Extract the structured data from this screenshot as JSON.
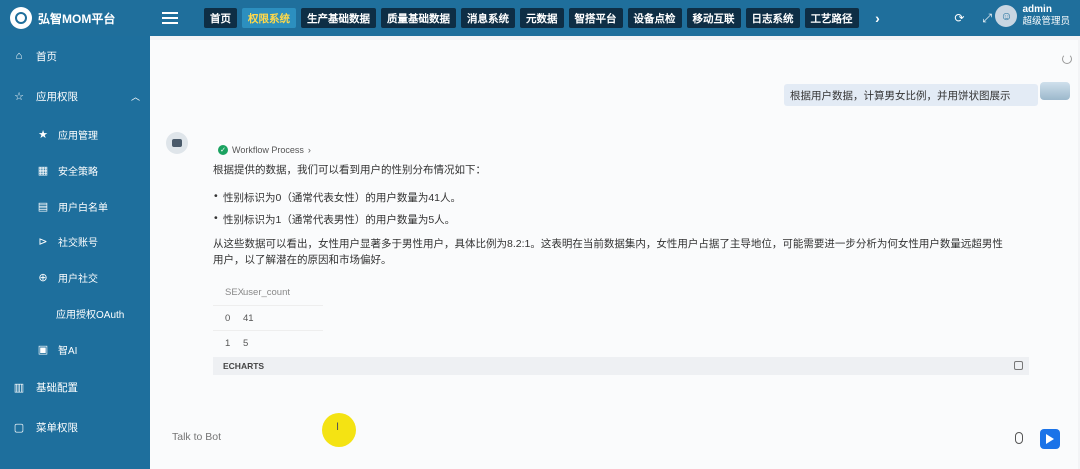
{
  "brand": {
    "name": "弘智MOM平台"
  },
  "nav": {
    "tabs": [
      "首页",
      "权限系统",
      "生产基础数据",
      "质量基础数据",
      "消息系统",
      "元数据",
      "智搭平台",
      "设备点检",
      "移动互联",
      "日志系统",
      "工艺路径"
    ],
    "active": "权限系统",
    "more": "›"
  },
  "user": {
    "name": "admin",
    "role": "超级管理员"
  },
  "sidebar": {
    "home": "首页",
    "app_perm": "应用权限",
    "app_mgmt": "应用管理",
    "security": "安全策略",
    "whitelist": "用户白名单",
    "social_account": "社交账号",
    "user_social": "用户社交",
    "oauth": "应用授权OAuth",
    "ai": "智AI",
    "base_config": "基础配置",
    "menu_perm": "菜单权限"
  },
  "chat": {
    "user_message": "根据用户数据，计算男女比例，并用饼状图展示",
    "workflow_label": "Workflow Process",
    "workflow_chevron": "›",
    "intro": "根据提供的数据，我们可以看到用户的性别分布情况如下：",
    "bullets": [
      "性别标识为0（通常代表女性）的用户数量为41人。",
      "性别标识为1（通常代表男性）的用户数量为5人。"
    ],
    "conclusion_line1": "从这些数据可以看出，女性用户显著多于男性用户，具体比例为8.2:1。这表明在当前数据集内，女性用户占据了主导地位，可能需要进一步分析为何女性用户数量远超男性",
    "conclusion_line2": "用户，以了解潜在的原因和市场偏好。",
    "table": {
      "headers": [
        "SEX",
        "user_count"
      ],
      "rows": [
        [
          "0",
          "41"
        ],
        [
          "1",
          "5"
        ]
      ]
    },
    "echarts_label": "ECHARTS",
    "input_placeholder": "Talk to Bot",
    "cursor_glyph": "I"
  }
}
